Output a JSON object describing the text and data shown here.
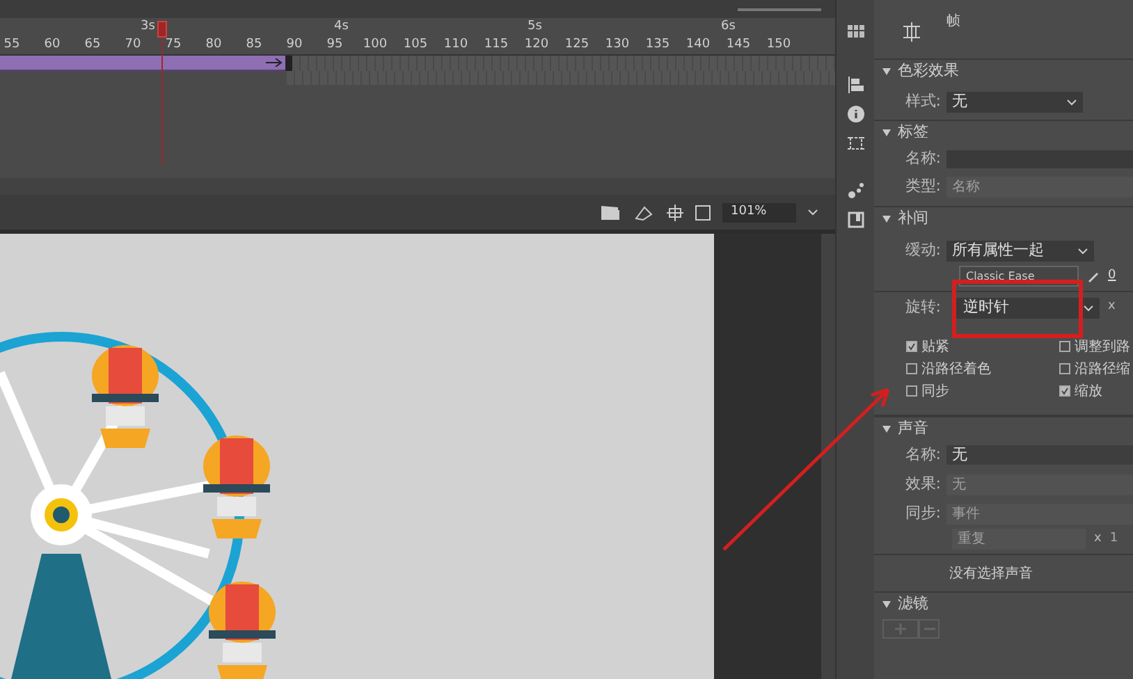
{
  "timeline": {
    "seconds": [
      "3s",
      "4s",
      "5s",
      "6s"
    ],
    "frames": [
      "55",
      "60",
      "65",
      "70",
      "75",
      "80",
      "85",
      "90",
      "95",
      "100",
      "105",
      "110",
      "115",
      "120",
      "125",
      "130",
      "135",
      "140",
      "145",
      "150"
    ]
  },
  "stage_toolbar": {
    "zoom": "101%"
  },
  "properties": {
    "header": "帧",
    "color_effect": {
      "title": "色彩效果",
      "expanded": true,
      "style_label": "样式:",
      "style_value": "无"
    },
    "label": {
      "title": "标签",
      "expanded": true,
      "name_label": "名称:",
      "type_label": "类型:",
      "type_placeholder": "名称"
    },
    "tween": {
      "title": "补间",
      "expanded": true,
      "ease_label": "缓动:",
      "ease_value": "所有属性一起",
      "ease_preset": "Classic Ease",
      "ease_amount": "0",
      "rotate_label": "旋转:",
      "rotate_value": "逆时针",
      "rotate_times": "x",
      "options": [
        {
          "label": "贴紧",
          "checked": true
        },
        {
          "label": "调整到路",
          "checked": false
        },
        {
          "label": "沿路径着色",
          "checked": false
        },
        {
          "label": "沿路径缩",
          "checked": false
        },
        {
          "label": "同步",
          "checked": false
        },
        {
          "label": "缩放",
          "checked": true
        }
      ]
    },
    "sound": {
      "title": "声音",
      "expanded": true,
      "name_label": "名称:",
      "name_value": "无",
      "effect_label": "效果:",
      "effect_value": "无",
      "sync_label": "同步:",
      "sync_value": "事件",
      "repeat_value": "重复",
      "repeat_times": "x",
      "repeat_count": "1",
      "empty_note": "没有选择声音"
    },
    "filters": {
      "title": "滤镜",
      "expanded": true
    }
  }
}
